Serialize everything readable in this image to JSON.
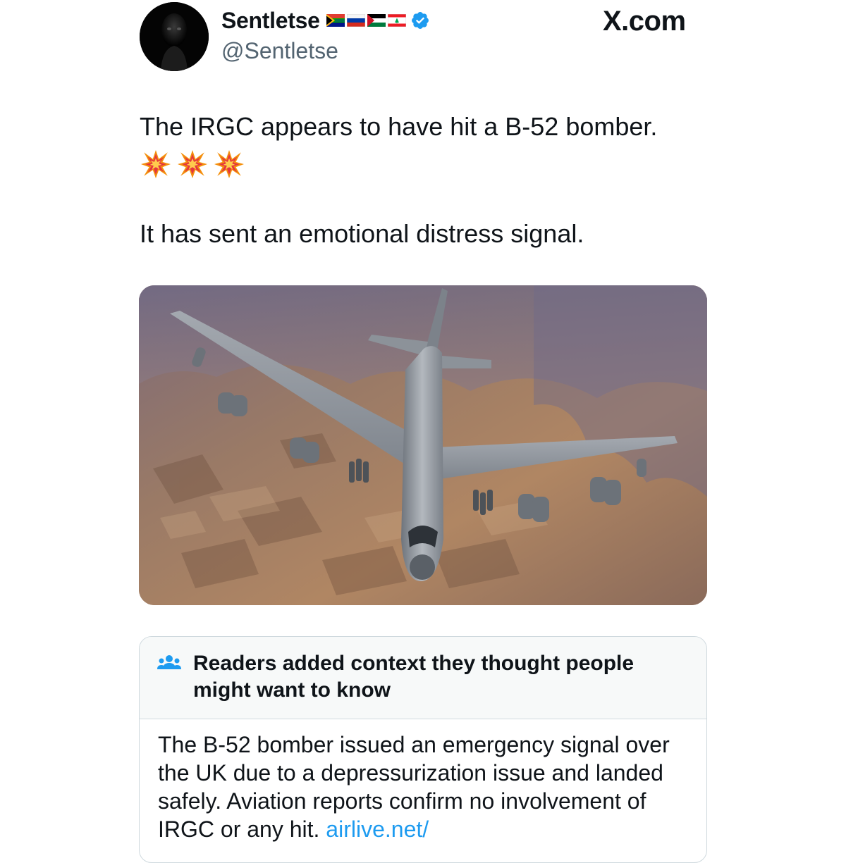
{
  "author": {
    "display_name": "Sentletse",
    "handle": "@Sentletse",
    "flags": [
      "south-africa-flag",
      "russia-flag",
      "palestine-flag",
      "lebanon-flag"
    ],
    "verified": true
  },
  "site_logo": "X.com",
  "post": {
    "line1": "The IRGC appears to have hit a B-52 bomber.",
    "emoji": [
      "collision-emoji",
      "collision-emoji",
      "collision-emoji"
    ],
    "line2": "It has sent an emotional distress signal."
  },
  "media": {
    "subject": "b52-bomber-photo"
  },
  "community_note": {
    "title": "Readers added context they thought people might want to know",
    "body": "The B-52 bomber issued an emergency signal over the UK due to a depressurization issue and landed safely. Aviation reports confirm no involvement of IRGC or any hit.",
    "link_text": "airlive.net/"
  },
  "colors": {
    "text": "#0f1419",
    "secondary_text": "#536471",
    "link": "#1d9bf0",
    "verified_badge": "#1d9bf0",
    "note_header_bg": "#f7f9f9",
    "border": "#cfd9de"
  }
}
